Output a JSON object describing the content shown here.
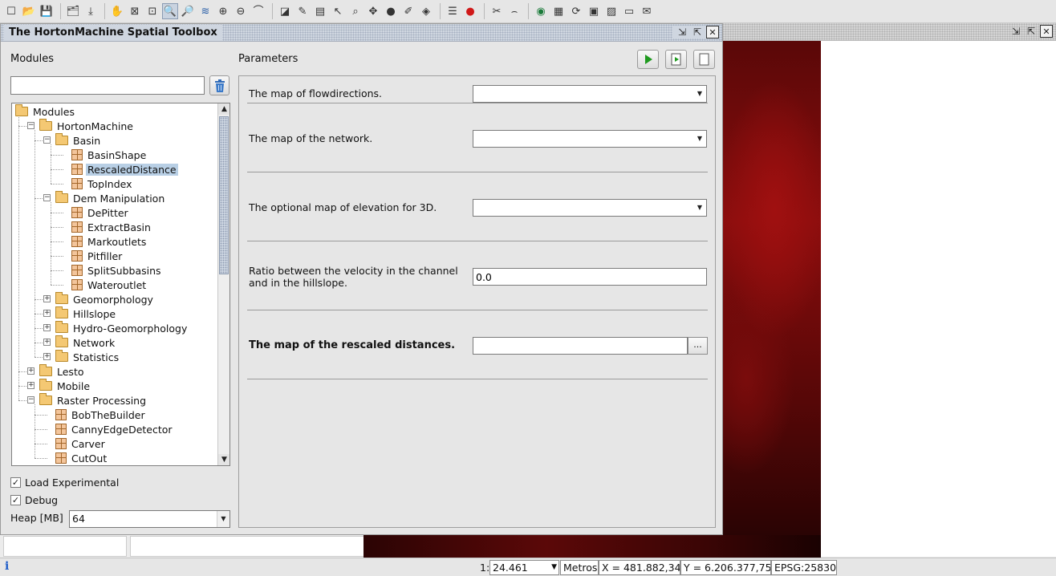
{
  "toolbar": {
    "icons": [
      "new-icon",
      "open-icon",
      "save-icon",
      "layers-icon",
      "export-icon",
      "pan-hand-icon",
      "zoom-extent-icon",
      "zoom-selection-icon",
      "zoom-box-icon",
      "zoom-out-icon",
      "layer-icon",
      "zoom-in-icon",
      "zoom-previous-icon",
      "zoom-next-icon",
      "select-icon",
      "edit-icon",
      "measure-icon",
      "pointer-icon",
      "magnify-icon",
      "star-icon",
      "ball-icon",
      "brush-icon",
      "transform-icon",
      "table-icon",
      "stop-icon",
      "tools-icon",
      "hat-icon",
      "globe-icon",
      "map-icon",
      "refresh-icon",
      "photo-icon",
      "image-icon",
      "landscape-icon",
      "plugin-icon"
    ],
    "glyphs": [
      "☐",
      "📂",
      "💾",
      "🗂",
      "⤓",
      "✋",
      "⊠",
      "⊡",
      "🔍",
      "🔎",
      "≋",
      "⊕",
      "⊖",
      "⌒",
      "◪",
      "✎",
      "▤",
      "↖",
      "⌕",
      "✥",
      "●",
      "✐",
      "◈",
      "☰",
      "●",
      "✂",
      "⌢",
      "◉",
      "▦",
      "⟳",
      "▣",
      "▨",
      "▭",
      "✉"
    ]
  },
  "toolbox": {
    "title": "The HortonMachine Spatial Toolbox",
    "modules_label": "Modules",
    "search_value": "",
    "parameters_label": "Parameters",
    "tree": [
      {
        "label": "Modules",
        "depth": 0,
        "type": "folder",
        "expanded": true
      },
      {
        "label": "HortonMachine",
        "depth": 1,
        "type": "folder",
        "expanded": true
      },
      {
        "label": "Basin",
        "depth": 2,
        "type": "folder",
        "expanded": true
      },
      {
        "label": "BasinShape",
        "depth": 3,
        "type": "module"
      },
      {
        "label": "RescaledDistance",
        "depth": 3,
        "type": "module",
        "selected": true
      },
      {
        "label": "TopIndex",
        "depth": 3,
        "type": "module"
      },
      {
        "label": "Dem Manipulation",
        "depth": 2,
        "type": "folder",
        "expanded": true
      },
      {
        "label": "DePitter",
        "depth": 3,
        "type": "module"
      },
      {
        "label": "ExtractBasin",
        "depth": 3,
        "type": "module"
      },
      {
        "label": "Markoutlets",
        "depth": 3,
        "type": "module"
      },
      {
        "label": "Pitfiller",
        "depth": 3,
        "type": "module"
      },
      {
        "label": "SplitSubbasins",
        "depth": 3,
        "type": "module"
      },
      {
        "label": "Wateroutlet",
        "depth": 3,
        "type": "module"
      },
      {
        "label": "Geomorphology",
        "depth": 2,
        "type": "folder",
        "expanded": false
      },
      {
        "label": "Hillslope",
        "depth": 2,
        "type": "folder",
        "expanded": false
      },
      {
        "label": "Hydro-Geomorphology",
        "depth": 2,
        "type": "folder",
        "expanded": false
      },
      {
        "label": "Network",
        "depth": 2,
        "type": "folder",
        "expanded": false
      },
      {
        "label": "Statistics",
        "depth": 2,
        "type": "folder",
        "expanded": false
      },
      {
        "label": "Lesto",
        "depth": 1,
        "type": "folder",
        "expanded": false
      },
      {
        "label": "Mobile",
        "depth": 1,
        "type": "folder",
        "expanded": false
      },
      {
        "label": "Raster Processing",
        "depth": 1,
        "type": "folder",
        "expanded": true
      },
      {
        "label": "BobTheBuilder",
        "depth": 2,
        "type": "module"
      },
      {
        "label": "CannyEdgeDetector",
        "depth": 2,
        "type": "module"
      },
      {
        "label": "Carver",
        "depth": 2,
        "type": "module"
      },
      {
        "label": "CutOut",
        "depth": 2,
        "type": "module"
      }
    ],
    "load_experimental": {
      "label": "Load Experimental",
      "checked": true,
      "mark": "✓"
    },
    "debug": {
      "label": "Debug",
      "checked": true,
      "mark": "✓"
    },
    "heap": {
      "label": "Heap [MB]",
      "value": "64"
    },
    "params": {
      "flowdirections": {
        "label": "The map of flowdirections.",
        "value": ""
      },
      "network": {
        "label": "The map of the network.",
        "value": ""
      },
      "elevation": {
        "label": "The optional map of elevation for 3D.",
        "value": ""
      },
      "velocity_ratio": {
        "label": "Ratio between the velocity in the channel and in the hillslope.",
        "value": "0.0"
      },
      "output": {
        "label": "The map of the rescaled distances.",
        "value": "",
        "browse_label": "..."
      }
    }
  },
  "statusbar": {
    "scale_prefix": "1:",
    "scale_value": "24.461",
    "units": "Metros",
    "x_coord": "X = 481.882,34",
    "y_coord": "Y = 6.206.377,75",
    "epsg": "EPSG:25830"
  },
  "colors": {
    "selection": "#b8cfe5",
    "map_dark_red": "#5a0808",
    "map_bright_red": "#a01010",
    "run_green": "#1f9a1f",
    "info_blue": "#1d5cc9"
  }
}
